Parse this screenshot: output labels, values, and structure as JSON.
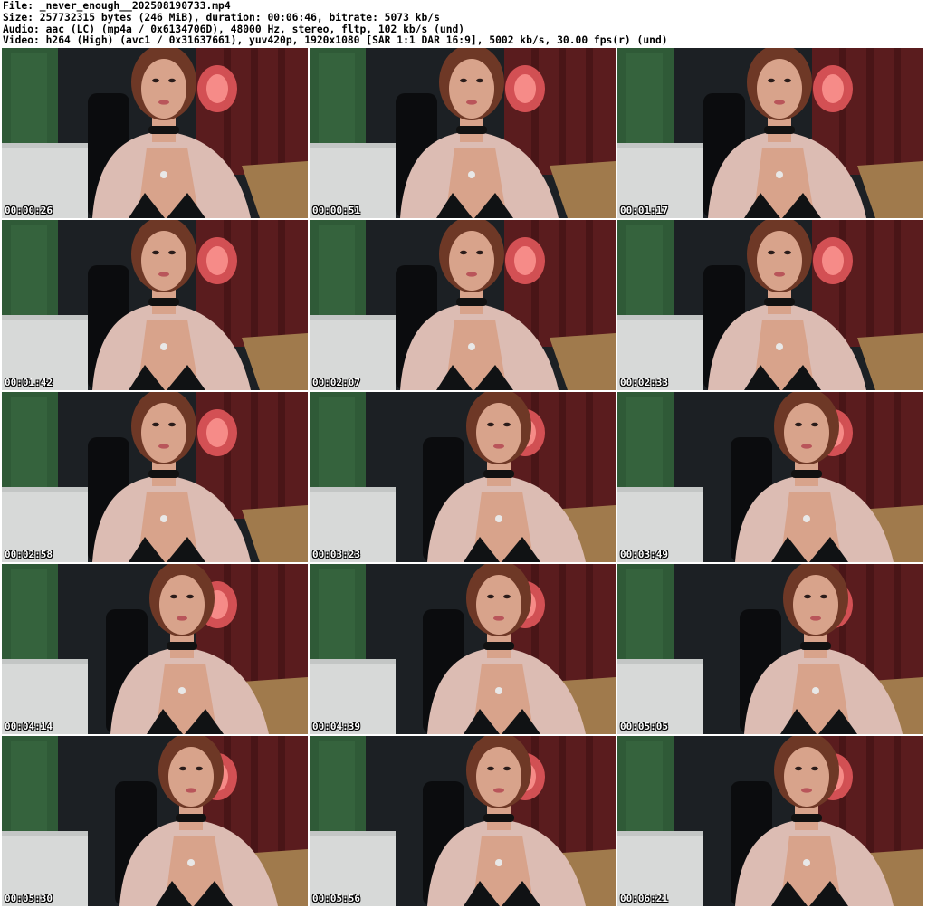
{
  "header": {
    "file_line": "File: _never_enough__202508190733.mp4",
    "size_line": "Size: 257732315 bytes (246 MiB), duration: 00:06:46, bitrate: 5073 kb/s",
    "audio_line": "Audio: aac (LC) (mp4a / 0x6134706D), 48000 Hz, stereo, fltp, 102 kb/s (und)",
    "video_line": "Video: h264 (High) (avc1 / 0x31637661), yuv420p, 1920x1080 [SAR 1:1 DAR 16:9], 5002 kb/s, 30.00 fps(r) (und)"
  },
  "frames": [
    {
      "timestamp": "00:00:26"
    },
    {
      "timestamp": "00:00:51"
    },
    {
      "timestamp": "00:01:17"
    },
    {
      "timestamp": "00:01:42"
    },
    {
      "timestamp": "00:02:07"
    },
    {
      "timestamp": "00:02:33"
    },
    {
      "timestamp": "00:02:58"
    },
    {
      "timestamp": "00:03:23"
    },
    {
      "timestamp": "00:03:49"
    },
    {
      "timestamp": "00:04:14"
    },
    {
      "timestamp": "00:04:39"
    },
    {
      "timestamp": "00:05:05"
    },
    {
      "timestamp": "00:05:30"
    },
    {
      "timestamp": "00:05:56"
    },
    {
      "timestamp": "00:06:21"
    }
  ],
  "colors": {
    "green_wall": "#2f5a37",
    "dark_room": "#1c2024",
    "red_curtain": "#5a1c1e",
    "lamp": "#e0575a",
    "bed": "#d7d9d8",
    "desk": "#a07a4c",
    "cardigan": "#dcbcb3",
    "skin": "#d8a38b",
    "hair": "#6e3826",
    "choker": "#111111",
    "top": "#101214"
  }
}
